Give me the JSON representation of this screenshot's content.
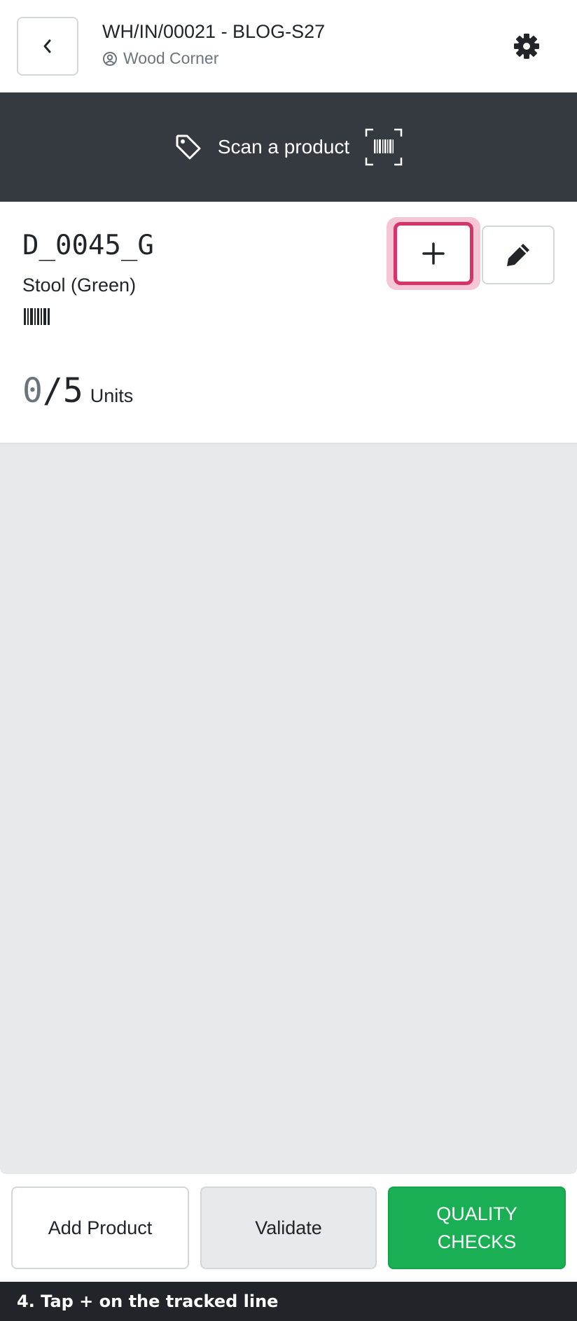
{
  "header": {
    "title": "WH/IN/00021 - BLOG-S27",
    "partner": "Wood Corner",
    "back_icon": "chevron-left-icon",
    "partner_icon": "user-circle-icon",
    "settings_icon": "gear-icon"
  },
  "scan_bar": {
    "label": "Scan a product",
    "tag_icon": "tag-icon",
    "barcode_icon": "barcode-scan-icon",
    "background": "#343a40"
  },
  "line": {
    "product_code": "D_0045_G",
    "product_name": "Stool (Green)",
    "qty_done": "0",
    "qty_separator": "/",
    "qty_total": "5",
    "uom": "Units",
    "plus_label": "+",
    "highlight_color": "#d63369"
  },
  "footer": {
    "add_product": "Add Product",
    "validate": "Validate",
    "quality_checks": "QUALITY CHECKS",
    "quality_color": "#1aaf55"
  },
  "tip": {
    "text": "4. Tap + on the tracked line"
  }
}
